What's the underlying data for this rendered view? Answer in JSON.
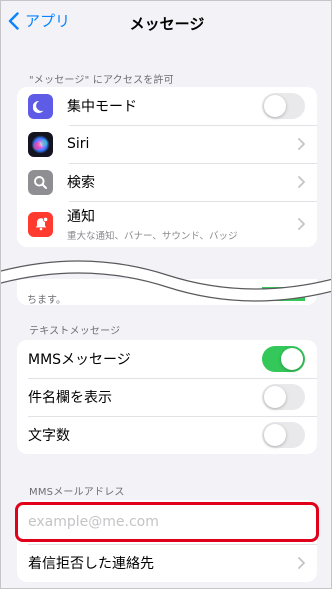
{
  "nav": {
    "back_label": "アプリ",
    "title": "メッセージ"
  },
  "access_section": {
    "header": "\"メッセージ\" にアクセスを許可",
    "items": [
      {
        "label": "集中モード",
        "icon": "moon-icon",
        "color": "#5e5ce6",
        "control": "toggle",
        "on": false
      },
      {
        "label": "Siri",
        "icon": "siri-icon",
        "control": "chevron"
      },
      {
        "label": "検索",
        "icon": "search-icon",
        "color": "#8e8e93",
        "control": "chevron"
      },
      {
        "label": "通知",
        "sublabel": "重大な通知、バナー、サウンド、バッジ",
        "icon": "notification-icon",
        "color": "#ff3b30",
        "control": "chevron"
      }
    ]
  },
  "partial_row": {
    "text": "ちます。",
    "toggle_on": true
  },
  "text_message_section": {
    "header": "テキストメッセージ",
    "items": [
      {
        "label": "MMSメッセージ",
        "on": true
      },
      {
        "label": "件名欄を表示",
        "on": false
      },
      {
        "label": "文字数",
        "on": false
      }
    ]
  },
  "mms_section": {
    "header": "MMSメールアドレス",
    "address_placeholder": "example@me.com",
    "blocked_label": "着信拒否した連絡先"
  },
  "colors": {
    "accent": "#0a84ff",
    "toggle_on": "#34c759",
    "highlight": "#e0001a"
  }
}
